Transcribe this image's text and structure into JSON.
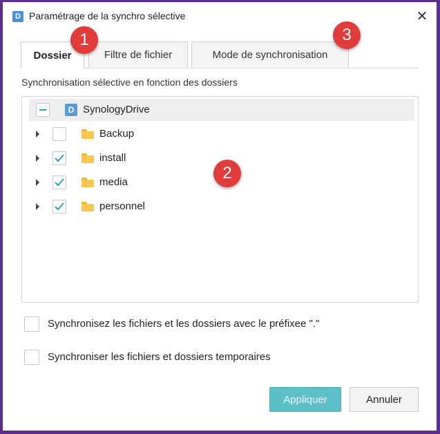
{
  "window": {
    "title": "Paramétrage de la synchro sélective",
    "app_icon_glyph": "D",
    "close_glyph": "✕"
  },
  "tabs": [
    {
      "label": "Dossier",
      "active": true
    },
    {
      "label": "Filtre de fichier",
      "active": false
    },
    {
      "label": "Mode de synchronisation",
      "active": false
    }
  ],
  "section_label": "Synchronisation sélective en fonction des dossiers",
  "tree": {
    "root": {
      "label": "SynologyDrive",
      "icon": "synology-drive-icon",
      "state": "partial"
    },
    "children": [
      {
        "label": "Backup",
        "checked": false,
        "icon": "folder-icon"
      },
      {
        "label": "install",
        "checked": true,
        "icon": "folder-icon"
      },
      {
        "label": "media",
        "checked": true,
        "icon": "folder-icon"
      },
      {
        "label": "personnel",
        "checked": true,
        "icon": "folder-icon"
      }
    ]
  },
  "options": [
    {
      "label": "Synchronisez les fichiers et les dossiers avec le préfixee \".\"",
      "checked": false
    },
    {
      "label": "Synchroniser les fichiers et dossiers temporaires",
      "checked": false
    }
  ],
  "buttons": {
    "apply": "Appliquer",
    "cancel": "Annuler"
  },
  "annotations": [
    "1",
    "2",
    "3"
  ],
  "colors": {
    "accent": "#22a7b5",
    "apply_bg": "#5bc0c8",
    "badge": "#e03c3c",
    "frame": "#5c2d8a"
  }
}
